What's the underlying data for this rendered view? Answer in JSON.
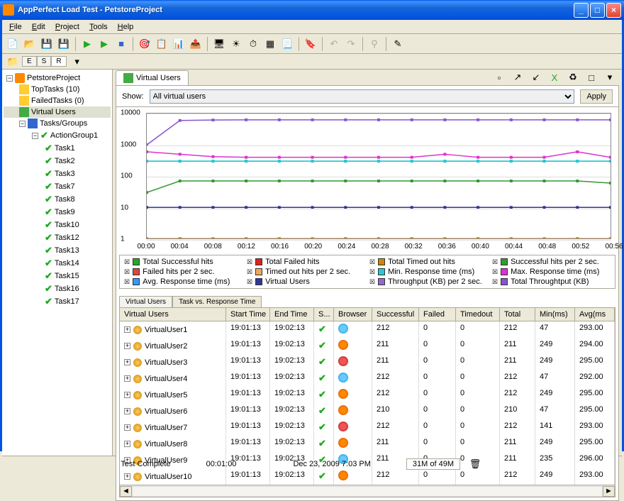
{
  "window": {
    "title": "AppPerfect Load Test - PetstoreProject"
  },
  "menus": [
    "File",
    "Edit",
    "Project",
    "Tools",
    "Help"
  ],
  "minitabs": [
    "E",
    "S",
    "R"
  ],
  "tree": {
    "project": "PetstoreProject",
    "top_tasks": "TopTasks (10)",
    "failed_tasks": "FailedTasks (0)",
    "virtual_users": "Virtual Users",
    "tasks_groups": "Tasks/Groups",
    "action_group": "ActionGroup1",
    "tasks": [
      "Task1",
      "Task2",
      "Task3",
      "Task7",
      "Task8",
      "Task9",
      "Task10",
      "Task12",
      "Task13",
      "Task14",
      "Task15",
      "Task16",
      "Task17"
    ]
  },
  "main_tab": "Virtual Users",
  "show_label": "Show:",
  "show_value": "All virtual users",
  "apply_label": "Apply",
  "legend": [
    "Total Successful hits",
    "Total Failed hits",
    "Total Timed out hits",
    "Successful hits per 2 sec.",
    "Failed hits per 2 sec.",
    "Timed out hits per 2 sec.",
    "Min. Response time (ms)",
    "Max. Response time (ms)",
    "Avg. Response time (ms)",
    "Virtual Users",
    "Throughput (KB) per 2 sec.",
    "Total Throughtput (KB)"
  ],
  "legend_colors": [
    "#2a2",
    "#d22",
    "#c80",
    "#393",
    "#d44",
    "#ea5",
    "#2cc",
    "#d3c",
    "#39f",
    "#339",
    "#96c",
    "#85c"
  ],
  "subtabs": [
    "Virtual Users",
    "Task vs. Response Time"
  ],
  "table": {
    "headers": [
      "Virtual Users",
      "Start Time",
      "End Time",
      "S...",
      "Browser",
      "Successful",
      "Failed",
      "Timedout",
      "Total",
      "Min(ms)",
      "Avg(ms"
    ],
    "rows": [
      {
        "name": "VirtualUser1",
        "start": "19:01:13",
        "end": "19:02:13",
        "browser": "ie",
        "succ": "212",
        "fail": "0",
        "to": "0",
        "total": "212",
        "min": "47",
        "avg": "293.00"
      },
      {
        "name": "VirtualUser2",
        "start": "19:01:13",
        "end": "19:02:13",
        "browser": "ff",
        "succ": "211",
        "fail": "0",
        "to": "0",
        "total": "211",
        "min": "249",
        "avg": "294.00"
      },
      {
        "name": "VirtualUser3",
        "start": "19:01:13",
        "end": "19:02:13",
        "browser": "op",
        "succ": "211",
        "fail": "0",
        "to": "0",
        "total": "211",
        "min": "249",
        "avg": "295.00"
      },
      {
        "name": "VirtualUser4",
        "start": "19:01:13",
        "end": "19:02:13",
        "browser": "ie",
        "succ": "212",
        "fail": "0",
        "to": "0",
        "total": "212",
        "min": "47",
        "avg": "292.00"
      },
      {
        "name": "VirtualUser5",
        "start": "19:01:13",
        "end": "19:02:13",
        "browser": "ff",
        "succ": "212",
        "fail": "0",
        "to": "0",
        "total": "212",
        "min": "249",
        "avg": "295.00"
      },
      {
        "name": "VirtualUser6",
        "start": "19:01:13",
        "end": "19:02:13",
        "browser": "ff",
        "succ": "210",
        "fail": "0",
        "to": "0",
        "total": "210",
        "min": "47",
        "avg": "295.00"
      },
      {
        "name": "VirtualUser7",
        "start": "19:01:13",
        "end": "19:02:13",
        "browser": "op",
        "succ": "212",
        "fail": "0",
        "to": "0",
        "total": "212",
        "min": "141",
        "avg": "293.00"
      },
      {
        "name": "VirtualUser8",
        "start": "19:01:13",
        "end": "19:02:13",
        "browser": "ff",
        "succ": "211",
        "fail": "0",
        "to": "0",
        "total": "211",
        "min": "249",
        "avg": "295.00"
      },
      {
        "name": "VirtualUser9",
        "start": "19:01:13",
        "end": "19:02:13",
        "browser": "ie",
        "succ": "211",
        "fail": "0",
        "to": "0",
        "total": "211",
        "min": "235",
        "avg": "296.00"
      },
      {
        "name": "VirtualUser10",
        "start": "19:01:13",
        "end": "19:02:13",
        "browser": "ff",
        "succ": "212",
        "fail": "0",
        "to": "0",
        "total": "212",
        "min": "249",
        "avg": "293.00"
      }
    ]
  },
  "status": {
    "test_complete": "Test Complete",
    "elapsed": "00:01:00",
    "datetime": "Dec 23, 2009 7:03 PM",
    "memory": "31M of 49M"
  },
  "chart_data": {
    "type": "line",
    "y_scale": "log",
    "ylim": [
      1,
      10000
    ],
    "y_ticks": [
      1,
      10,
      100,
      1000,
      10000
    ],
    "x_ticks": [
      "00:00",
      "00:04",
      "00:08",
      "00:12",
      "00:16",
      "00:20",
      "00:24",
      "00:28",
      "00:32",
      "00:36",
      "00:40",
      "00:44",
      "00:48",
      "00:52",
      "00:56"
    ],
    "xlabel": "",
    "ylabel": "",
    "series": [
      {
        "name": "Total Throughtput (KB)",
        "color": "#85c",
        "values": [
          1000,
          6000,
          6200,
          6300,
          6300,
          6300,
          6300,
          6300,
          6300,
          6300,
          6300,
          6300,
          6300,
          6300,
          6300
        ]
      },
      {
        "name": "Max. Response time (ms)",
        "color": "#d3c",
        "values": [
          600,
          500,
          420,
          400,
          400,
          400,
          400,
          400,
          400,
          500,
          400,
          400,
          400,
          600,
          400
        ]
      },
      {
        "name": "Avg. Response time (ms)",
        "color": "#39f",
        "values": [
          300,
          300,
          300,
          300,
          300,
          300,
          300,
          300,
          300,
          300,
          300,
          300,
          300,
          300,
          300
        ]
      },
      {
        "name": "Min. Response time (ms)",
        "color": "#2cc",
        "values": [
          300,
          300,
          300,
          300,
          300,
          300,
          300,
          300,
          300,
          300,
          300,
          300,
          300,
          300,
          300
        ]
      },
      {
        "name": "Successful hits per 2 sec.",
        "color": "#393",
        "values": [
          30,
          70,
          70,
          70,
          70,
          70,
          70,
          70,
          70,
          70,
          70,
          70,
          70,
          70,
          60
        ]
      },
      {
        "name": "Virtual Users",
        "color": "#339",
        "values": [
          10,
          10,
          10,
          10,
          10,
          10,
          10,
          10,
          10,
          10,
          10,
          10,
          10,
          10,
          10
        ]
      },
      {
        "name": "Total Failed hits",
        "color": "#d22",
        "values": [
          1,
          1,
          1,
          1,
          1,
          1,
          1,
          1,
          1,
          1,
          1,
          1,
          1,
          1,
          1
        ]
      },
      {
        "name": "Total Timed out hits",
        "color": "#c80",
        "values": [
          1,
          1,
          1,
          1,
          1,
          1,
          1,
          1,
          1,
          1,
          1,
          1,
          1,
          1,
          1
        ]
      }
    ]
  }
}
